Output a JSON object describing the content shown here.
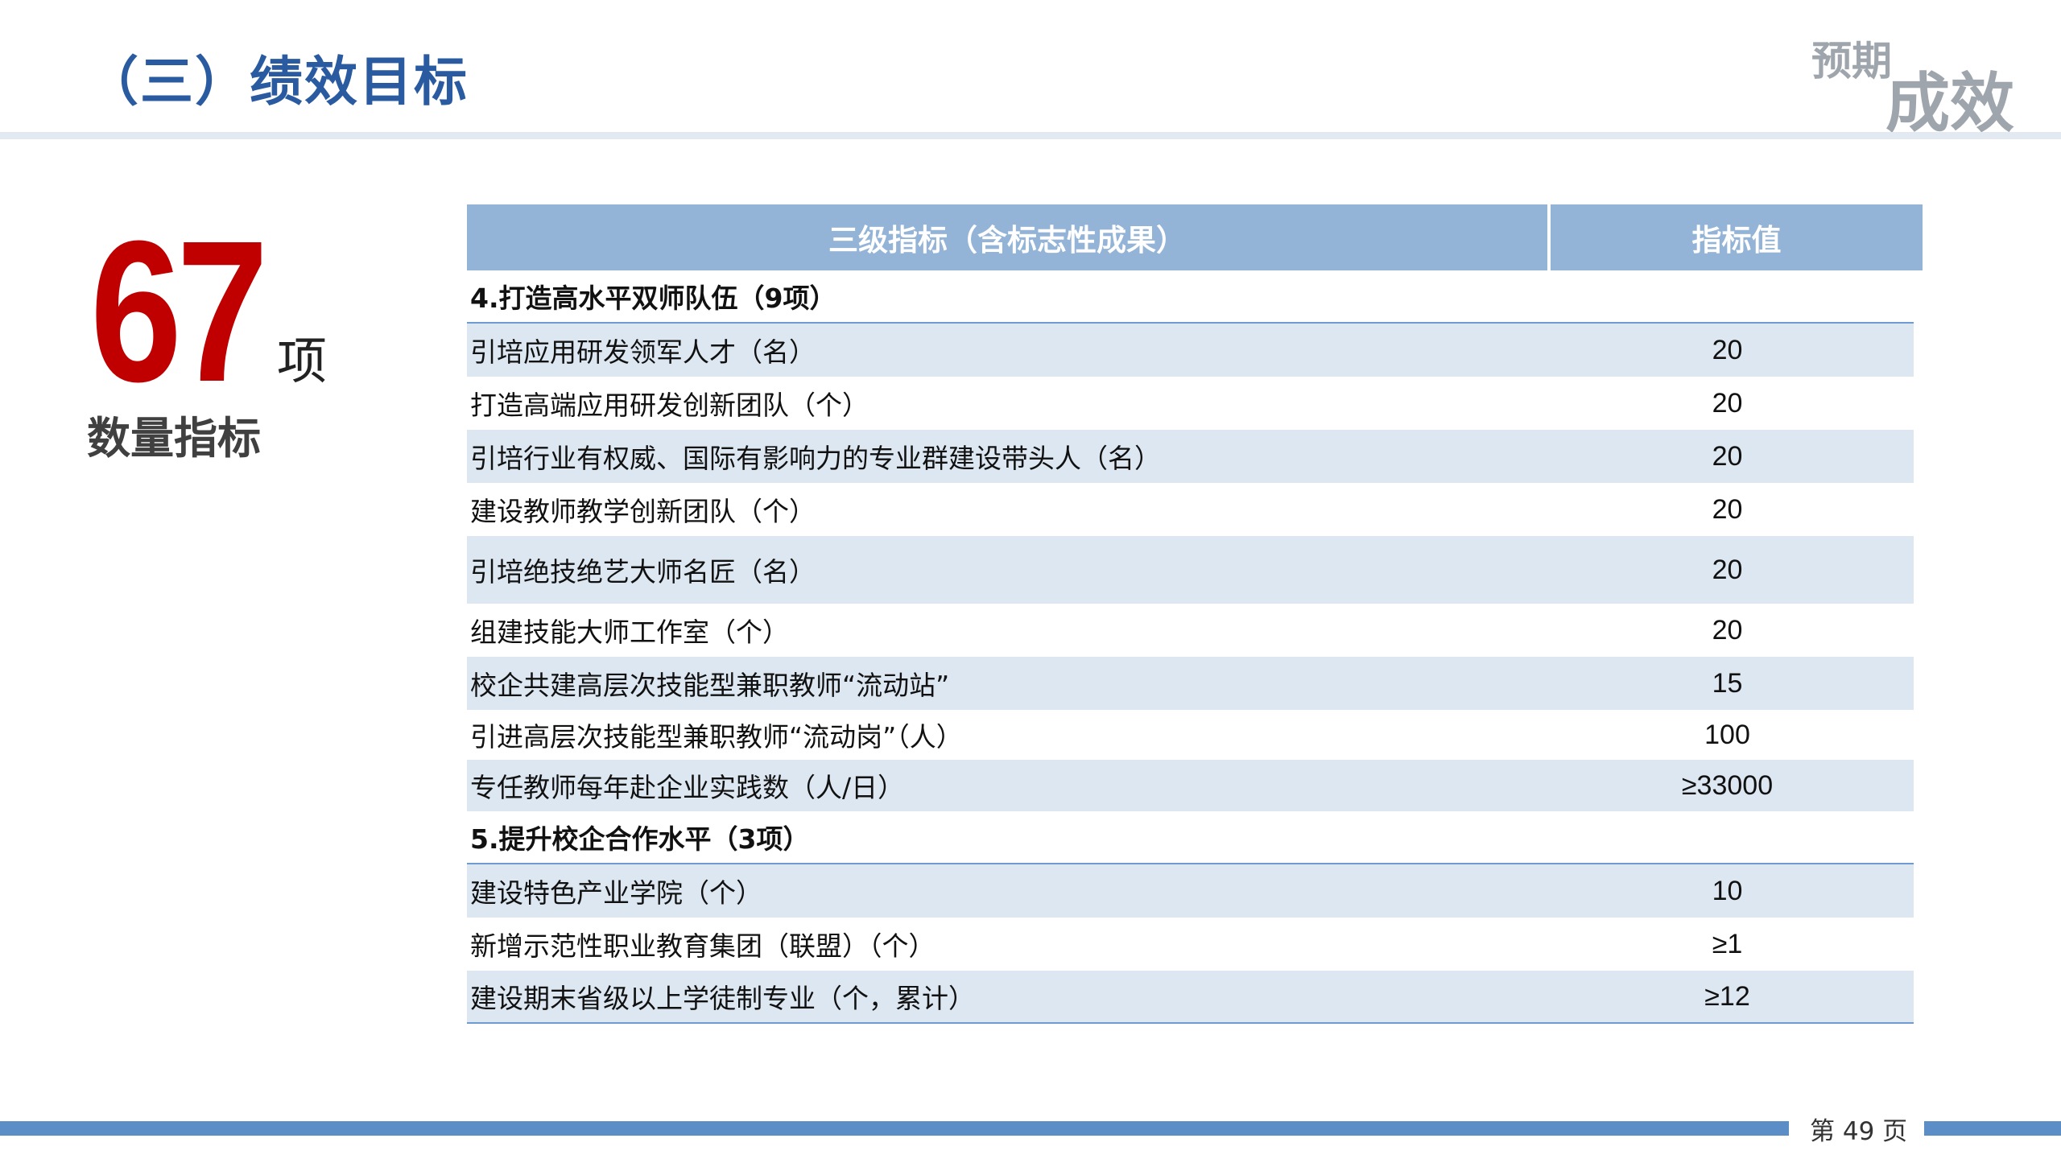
{
  "slide": {
    "title": "（三）绩效目标",
    "logo_line1": "预期",
    "logo_line2": "成效",
    "big_number": "67",
    "unit": "项",
    "count_label": "数量指标",
    "page_number": "第 49 页"
  },
  "table": {
    "headers": [
      "三级指标（含标志性成果）",
      "指标值"
    ],
    "sections": [
      {
        "title": "4.打造高水平双师队伍（9项）",
        "rows": [
          {
            "name": "引培应用研发领军人才（名）",
            "value": "20"
          },
          {
            "name": "打造高端应用研发创新团队（个）",
            "value": "20"
          },
          {
            "name": "引培行业有权威、国际有影响力的专业群建设带头人（名）",
            "value": "20"
          },
          {
            "name": "建设教师教学创新团队（个）",
            "value": "20"
          },
          {
            "name": "引培绝技绝艺大师名匠（名）",
            "value": "20"
          },
          {
            "name": "组建技能大师工作室（个）",
            "value": "20"
          },
          {
            "name": "校企共建高层次技能型兼职教师“流动站”",
            "value": "15"
          },
          {
            "name": "引进高层次技能型兼职教师“流动岗”（人）",
            "value": "100"
          },
          {
            "name": "专任教师每年赴企业实践数（人/日）",
            "value": "≥33000"
          }
        ]
      },
      {
        "title": "5.提升校企合作水平（3项）",
        "rows": [
          {
            "name": "建设特色产业学院（个）",
            "value": "10"
          },
          {
            "name": "新增示范性职业教育集团（联盟）（个）",
            "value": "≥1"
          },
          {
            "name": "建设期末省级以上学徒制专业（个，累计）",
            "value": "≥12"
          }
        ]
      }
    ]
  }
}
